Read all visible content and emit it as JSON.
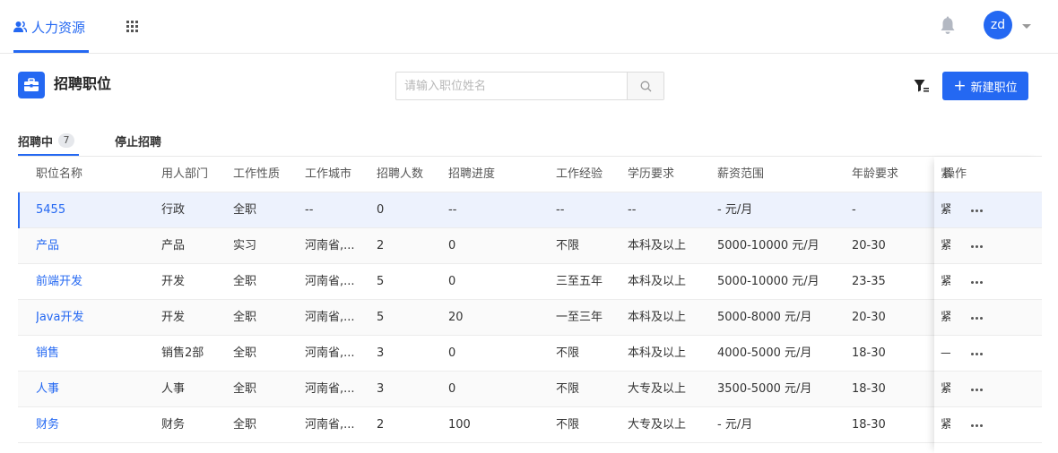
{
  "nav": {
    "brand": "人力资源",
    "avatar": "zd"
  },
  "page": {
    "title": "招聘职位"
  },
  "search": {
    "placeholder": "请输入职位姓名",
    "value": ""
  },
  "toolbar": {
    "new_label": "新建职位"
  },
  "tabs": [
    {
      "label": "招聘中",
      "count": "7"
    },
    {
      "label": "停止招聘"
    }
  ],
  "table": {
    "columns": [
      "职位名称",
      "用人部门",
      "工作性质",
      "工作城市",
      "招聘人数",
      "招聘进度",
      "工作经验",
      "学历要求",
      "薪资范围",
      "年龄要求",
      "紧",
      "操作"
    ],
    "rows": [
      {
        "name": "5455",
        "dept": "行政",
        "type": "全职",
        "city": "--",
        "headcount": "0",
        "progress": "--",
        "experience": "--",
        "education": "--",
        "salary": "- 元/月",
        "age": "-",
        "urgent": "紧"
      },
      {
        "name": "产品",
        "dept": "产品",
        "type": "实习",
        "city": "河南省,...",
        "headcount": "2",
        "progress": "0",
        "experience": "不限",
        "education": "本科及以上",
        "salary": "5000-10000 元/月",
        "age": "20-30",
        "urgent": "紧"
      },
      {
        "name": "前端开发",
        "dept": "开发",
        "type": "全职",
        "city": "河南省,...",
        "headcount": "5",
        "progress": "0",
        "experience": "三至五年",
        "education": "本科及以上",
        "salary": "5000-10000 元/月",
        "age": "23-35",
        "urgent": "紧"
      },
      {
        "name": "Java开发",
        "dept": "开发",
        "type": "全职",
        "city": "河南省,...",
        "headcount": "5",
        "progress": "20",
        "experience": "一至三年",
        "education": "本科及以上",
        "salary": "5000-8000 元/月",
        "age": "20-30",
        "urgent": "紧"
      },
      {
        "name": "销售",
        "dept": "销售2部",
        "type": "全职",
        "city": "河南省,...",
        "headcount": "3",
        "progress": "0",
        "experience": "不限",
        "education": "本科及以上",
        "salary": "4000-5000 元/月",
        "age": "18-30",
        "urgent": "—"
      },
      {
        "name": "人事",
        "dept": "人事",
        "type": "全职",
        "city": "河南省,...",
        "headcount": "3",
        "progress": "0",
        "experience": "不限",
        "education": "大专及以上",
        "salary": "3500-5000 元/月",
        "age": "18-30",
        "urgent": "紧"
      },
      {
        "name": "财务",
        "dept": "财务",
        "type": "全职",
        "city": "河南省,...",
        "headcount": "2",
        "progress": "100",
        "experience": "不限",
        "education": "大专及以上",
        "salary": "- 元/月",
        "age": "18-30",
        "urgent": "紧"
      }
    ]
  },
  "colors": {
    "accent": "#2468f2",
    "selected_row": "#edf2fd"
  }
}
